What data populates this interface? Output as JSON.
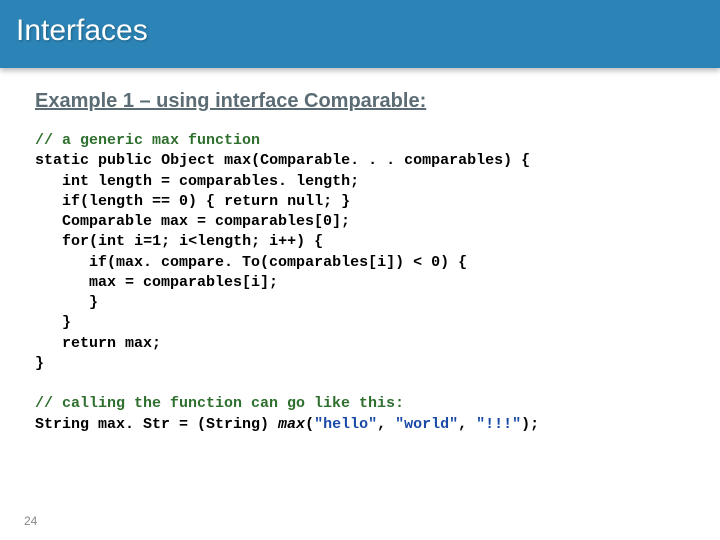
{
  "title": "Interfaces",
  "subtitle": "Example 1 – using interface Comparable:",
  "code": {
    "c1": "// a generic max function",
    "kw_static": "static",
    "kw_public": "public",
    "t_object": "Object max(Comparable. . . comparables) {",
    "kw_int1": "int",
    "t_len": " length = comparables. length;",
    "kw_if1": "if",
    "t_if1_a": "(length == 0) { ",
    "kw_ret1": "return",
    "kw_null": "null",
    "t_if1_b": "; }",
    "t_max0": "Comparable max = comparables[0];",
    "kw_for": "for",
    "t_for_a": "(",
    "kw_int2": "int",
    "t_for_b": " i=1; i<length; i++) {",
    "kw_if2": "if",
    "t_if2": "(max. compare. To(comparables[i]) < 0) {",
    "t_assign": "max = comparables[i];",
    "t_rb1": "}",
    "t_rb2": "}",
    "kw_ret2": "return",
    "t_retmax": " max;",
    "t_rb3": "}",
    "c2": "// calling the function can go like this:",
    "t_call_a": "String max. Str = (String) ",
    "it_max": "max",
    "t_call_b": "(",
    "s1": "\"hello\"",
    "t_c1": ", ",
    "s2": "\"world\"",
    "t_c2": ", ",
    "s3": "\"!!!\"",
    "t_call_c": ");"
  },
  "pagenum": "24"
}
